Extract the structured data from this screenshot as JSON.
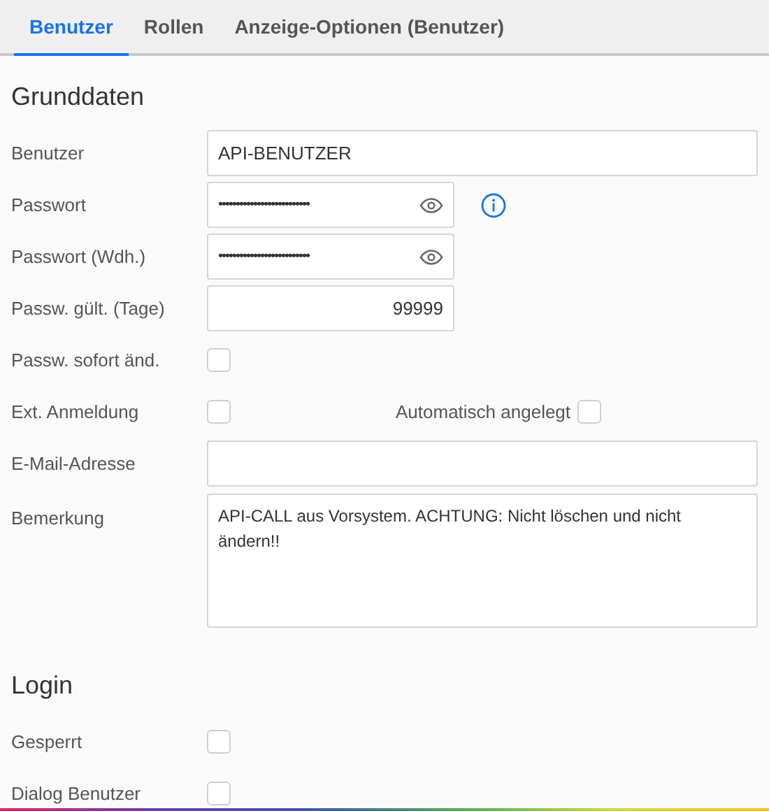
{
  "tabs": [
    {
      "label": "Benutzer",
      "selected": true
    },
    {
      "label": "Rollen",
      "selected": false
    },
    {
      "label": "Anzeige-Optionen (Benutzer)",
      "selected": false
    }
  ],
  "sections": [
    {
      "title": "Grunddaten",
      "rows": [
        {
          "kind": "text",
          "label": "Benutzer",
          "value": "API-BENUTZER"
        },
        {
          "kind": "password",
          "label": "Passwort",
          "value": "••••••••••••••••••••••••••",
          "info": true
        },
        {
          "kind": "password",
          "label": "Passwort (Wdh.)",
          "value": "••••••••••••••••••••••••••",
          "info": false
        },
        {
          "kind": "number",
          "label": "Passw. gült. (Tage)",
          "value": "99999"
        },
        {
          "kind": "checkbox",
          "label": "Passw. sofort änd.",
          "checked": false
        },
        {
          "kind": "checkbox",
          "label": "Ext. Anmeldung",
          "checked": false,
          "extra": {
            "label": "Automatisch angelegt",
            "checked": false
          }
        },
        {
          "kind": "text",
          "label": "E-Mail-Adresse",
          "value": ""
        },
        {
          "kind": "textarea",
          "label": "Bemerkung",
          "value": "API-CALL aus Vorsystem. ACHTUNG: Nicht löschen und nicht ändern!!"
        }
      ]
    },
    {
      "title": "Login",
      "rows": [
        {
          "kind": "checkbox",
          "label": "Gesperrt",
          "checked": false
        },
        {
          "kind": "checkbox",
          "label": "Dialog Benutzer",
          "checked": false
        }
      ]
    }
  ]
}
